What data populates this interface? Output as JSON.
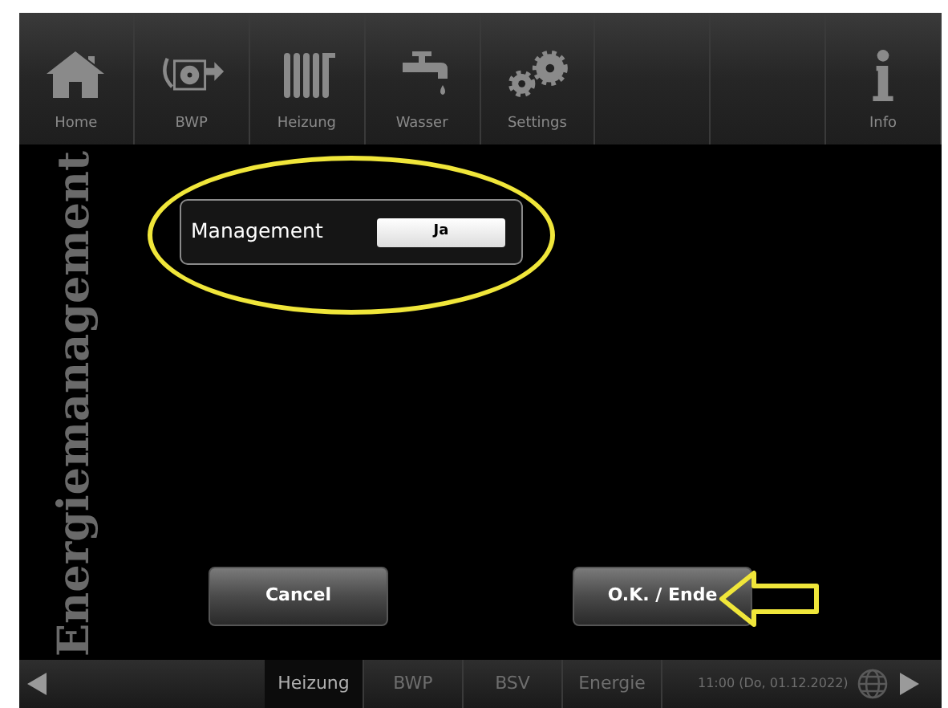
{
  "nav": [
    {
      "kind": "home",
      "label": "Home"
    },
    {
      "kind": "fan",
      "label": "BWP"
    },
    {
      "kind": "radiator",
      "label": "Heizung"
    },
    {
      "kind": "tap",
      "label": "Wasser"
    },
    {
      "kind": "gears",
      "label": "Settings"
    },
    {
      "kind": "empty"
    },
    {
      "kind": "empty"
    },
    {
      "kind": "info",
      "label": "Info"
    }
  ],
  "page_title": "Energiemanagement",
  "setting": {
    "label": "Management",
    "value": "Ja"
  },
  "buttons": [
    "Cancel",
    "O.K. / Ende"
  ],
  "bottom_tabs": [
    {
      "label": "Heizung",
      "selected": true
    },
    {
      "label": "BWP",
      "selected": false
    },
    {
      "label": "BSV",
      "selected": false
    },
    {
      "label": "Energie",
      "selected": false
    }
  ],
  "datetime": "11:00 (Do, 01.12.2022)"
}
